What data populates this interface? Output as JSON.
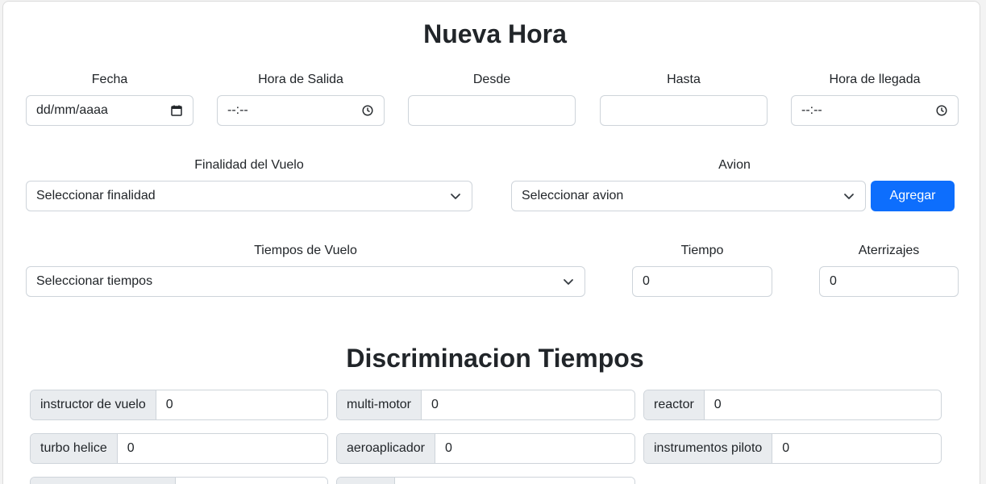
{
  "form": {
    "title": "Nueva Hora",
    "fecha": {
      "label": "Fecha",
      "placeholder": "dd/mm/aaaa"
    },
    "hora_salida": {
      "label": "Hora de Salida",
      "placeholder": "--:--"
    },
    "desde": {
      "label": "Desde",
      "value": ""
    },
    "hasta": {
      "label": "Hasta",
      "value": ""
    },
    "hora_llegada": {
      "label": "Hora de llegada",
      "placeholder": "--:--"
    },
    "finalidad": {
      "label": "Finalidad del Vuelo",
      "selected": "Seleccionar finalidad"
    },
    "avion": {
      "label": "Avion",
      "selected": "Seleccionar avion"
    },
    "agregar_label": "Agregar",
    "tiempos_vuelo": {
      "label": "Tiempos de Vuelo",
      "selected": "Seleccionar tiempos"
    },
    "tiempo": {
      "label": "Tiempo",
      "value": "0"
    },
    "aterrizajes": {
      "label": "Aterrizajes",
      "value": "0"
    }
  },
  "discriminacion": {
    "title": "Discriminacion Tiempos",
    "fields": [
      {
        "label": "instructor de vuelo",
        "value": "0"
      },
      {
        "label": "multi-motor",
        "value": "0"
      },
      {
        "label": "reactor",
        "value": "0"
      },
      {
        "label": "turbo helice",
        "value": "0"
      },
      {
        "label": "aeroaplicador",
        "value": "0"
      },
      {
        "label": "instrumentos piloto",
        "value": "0"
      }
    ]
  },
  "colors": {
    "primary": "#0d6efd",
    "border": "#ced4da",
    "addon_bg": "#e9ecef"
  }
}
